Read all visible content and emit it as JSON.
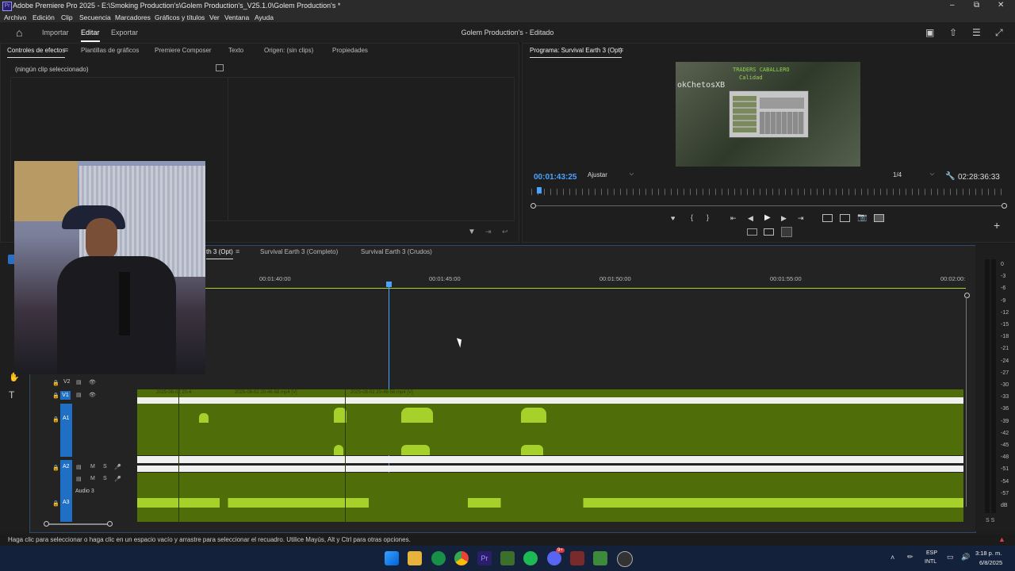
{
  "titlebar": {
    "title": "Adobe Premiere Pro 2025 - E:\\Smoking Production's\\Golem Production's_V25.1.0\\Golem Production's *",
    "app_icon": "Pr"
  },
  "menu": [
    "Archivo",
    "Edición",
    "Clip",
    "Secuencia",
    "Marcadores",
    "Gráficos y títulos",
    "Ver",
    "Ventana",
    "Ayuda"
  ],
  "header": {
    "tabs": [
      "Importar",
      "Editar",
      "Exportar"
    ],
    "active_tab": "Editar",
    "document_title": "Golem Production's - Editado"
  },
  "source_panel": {
    "tabs": [
      "Controles de efectos",
      "Plantillas de gráficos",
      "Premiere Composer",
      "Texto",
      "Origen: (sin clips)",
      "Propiedades"
    ],
    "empty_text": "(ningún clip seleccionado)"
  },
  "program": {
    "label": "Programa: Survival Earth 3 (Opt)",
    "timecode": "00:01:43:25",
    "fit": "Ajustar",
    "quality": "1/4",
    "duration": "02:28:36:33",
    "playhead_progress": 0.012,
    "frame_text": {
      "title": "TRADERS CABALLERO",
      "sub": "Calidad",
      "player": "okChetosXB"
    }
  },
  "timeline": {
    "tabs": [
      "Survival Earth 3 (Opt)",
      "Survival Earth 3 (Completo)",
      "Survival Earth 3 (Crudos)"
    ],
    "tab_visible_suffix": "th 3 (Opt)",
    "ruler": [
      "00:01:40:00",
      "00:01:45:00",
      "00:01:50:00",
      "00:01:55:00",
      "00:02:00:"
    ],
    "tracks": {
      "v2": "V2",
      "v1": "V1",
      "a1": "A1",
      "a2": "A2",
      "a3": "A3",
      "audio3_name": "Audio 3"
    },
    "clips": [
      "2025-08-02 20-4",
      "2025-08-02 20-46-58.mp4 [V]",
      "2025-08-02 20-46-58.mp4 [V]"
    ]
  },
  "meter": {
    "labels": [
      "0",
      "-3",
      "-6",
      "-9",
      "-12",
      "-15",
      "-18",
      "-21",
      "-24",
      "-27",
      "-30",
      "-33",
      "-36",
      "-39",
      "-42",
      "-45",
      "-48",
      "-51",
      "-54",
      "-57",
      "dB"
    ],
    "footer": "S S"
  },
  "status_text": "Haga clic para seleccionar o haga clic en un espacio vacío y arrastre para seleccionar el recuadro. Utilice Mayús, Alt y Ctrl para otras opciones.",
  "taskbar": {
    "lang1": "ESP",
    "lang2": "INTL",
    "time": "3:18 p. m.",
    "date": "6/8/2025",
    "discord_badge": "9+"
  },
  "colors": {
    "accent_blue": "#4aa3ff",
    "track_blue": "#1f6fc4",
    "audio_green": "#4f6e0a",
    "wave_green": "#a6d12b",
    "timeline_border": "#2e4a6a"
  }
}
